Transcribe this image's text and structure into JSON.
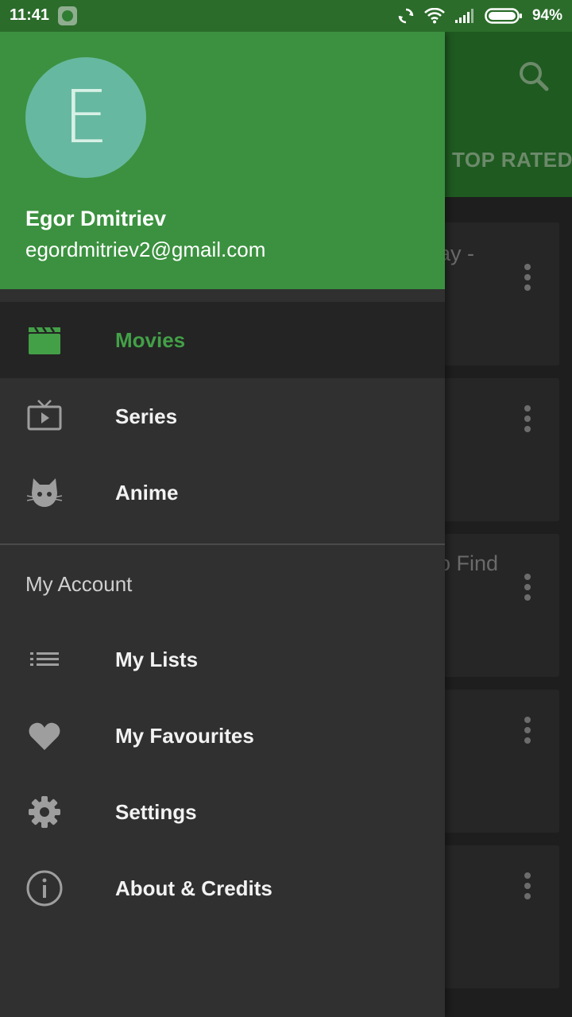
{
  "status_bar": {
    "time": "11:41",
    "battery": "94%"
  },
  "background": {
    "tab_label": "TOP RATED",
    "cards": [
      {
        "text": "ay -"
      },
      {
        "text": ""
      },
      {
        "text": "o Find"
      },
      {
        "text": ""
      },
      {
        "text": ""
      }
    ]
  },
  "drawer": {
    "avatar_initial": "E",
    "user_name": "Egor Dmitriev",
    "user_email": "egordmitriev2@gmail.com",
    "section_header": "My Account",
    "items": [
      {
        "label": "Movies",
        "icon": "clapperboard-icon",
        "active": true
      },
      {
        "label": "Series",
        "icon": "tv-icon"
      },
      {
        "label": "Anime",
        "icon": "cat-icon"
      },
      {
        "label": "My Lists",
        "icon": "list-icon"
      },
      {
        "label": "My Favourites",
        "icon": "heart-icon"
      },
      {
        "label": "Settings",
        "icon": "gear-icon"
      },
      {
        "label": "About & Credits",
        "icon": "info-icon"
      }
    ]
  },
  "colors": {
    "accent": "#43a047",
    "header": "#3b913f",
    "avatar": "#67b8a0",
    "drawer_bg": "#303030"
  }
}
